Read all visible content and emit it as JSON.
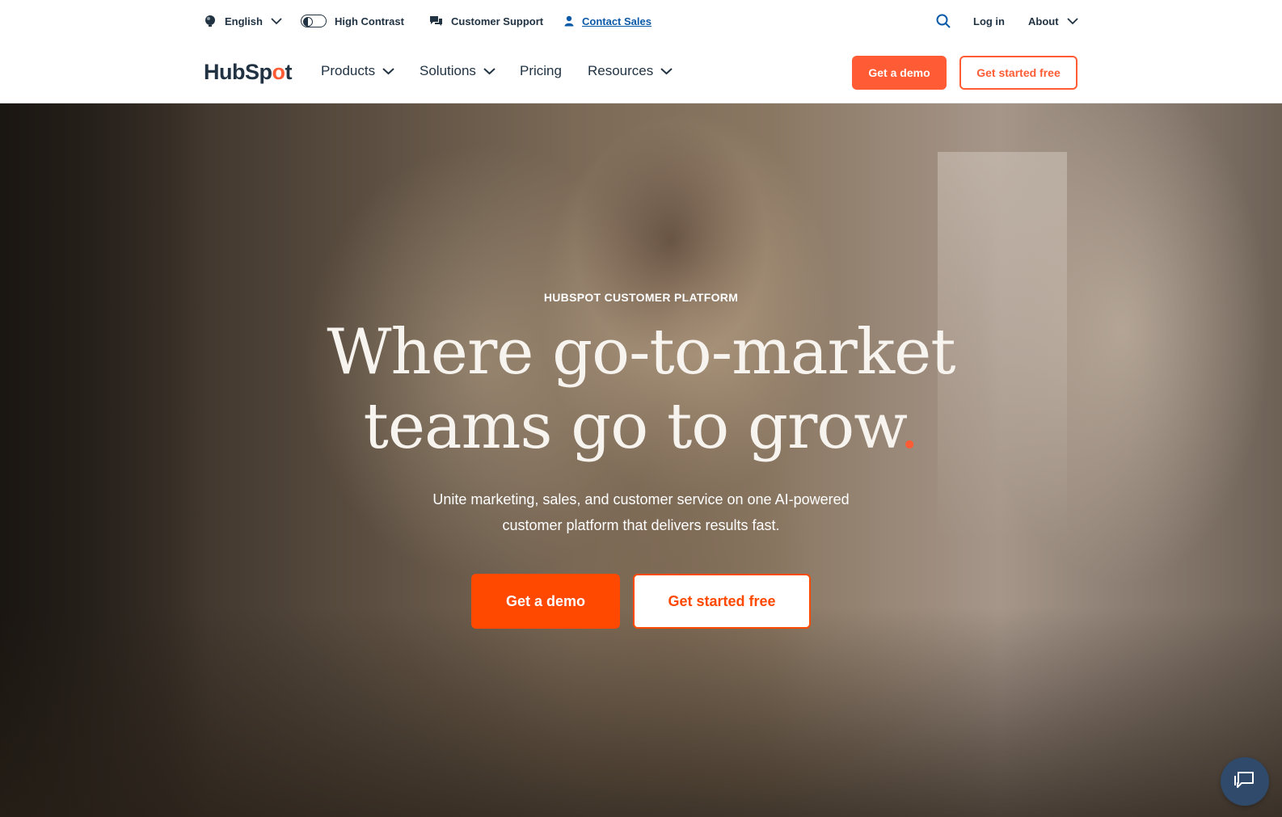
{
  "utility_bar": {
    "language": "English",
    "high_contrast": "High Contrast",
    "customer_support": "Customer Support",
    "contact_sales": "Contact Sales",
    "login": "Log in",
    "about": "About"
  },
  "nav": {
    "logo": {
      "hub": "HubSp",
      "spot": "o",
      "tail": "t"
    },
    "items": [
      {
        "label": "Products"
      },
      {
        "label": "Solutions"
      },
      {
        "label": "Pricing"
      },
      {
        "label": "Resources"
      }
    ],
    "get_demo": "Get a demo",
    "get_started": "Get started free"
  },
  "hero": {
    "eyebrow": "HUBSPOT CUSTOMER PLATFORM",
    "headline_line1": "Where go-to-market",
    "headline_line2": "teams go to grow",
    "headline_dot": ".",
    "subhead_line1": "Unite marketing, sales, and customer service on one AI-powered",
    "subhead_line2": "customer platform that delivers results fast.",
    "get_demo": "Get a demo",
    "get_started": "Get started free"
  },
  "colors": {
    "brand_orange": "#ff5c35",
    "cta_orange": "#ff4800",
    "navy": "#213343",
    "link_blue": "#0b5aa8"
  },
  "icons": {
    "language": "globe-icon",
    "contrast": "toggle-icon",
    "support": "chat-bubbles-icon",
    "sales": "person-icon",
    "search": "search-icon",
    "chat": "chat-widget-icon"
  }
}
